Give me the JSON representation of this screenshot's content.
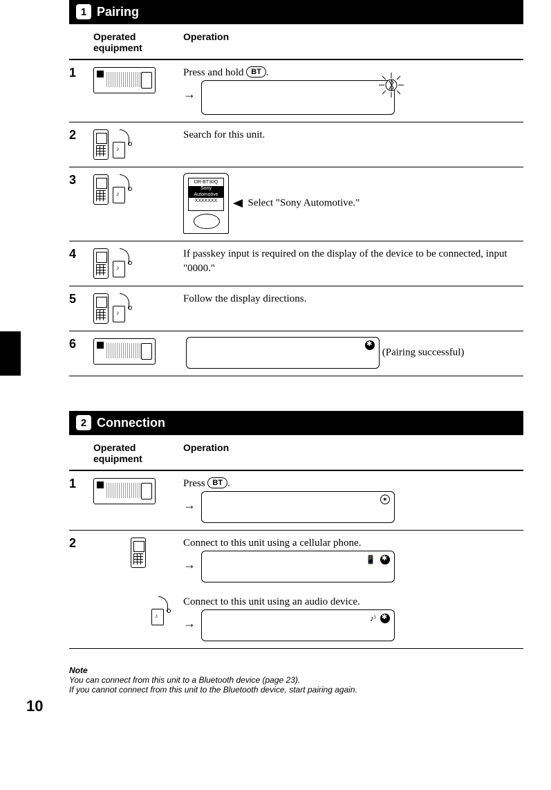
{
  "sections": {
    "pairing": {
      "badge": "1",
      "title": "Pairing",
      "col_equipment": "Operated equipment",
      "col_operation": "Operation",
      "steps": {
        "s1": {
          "num": "1",
          "text_a": "Press and hold ",
          "btn": "BT",
          "text_b": "."
        },
        "s2": {
          "num": "2",
          "text": "Search for this unit."
        },
        "s3": {
          "num": "3",
          "device_lines": {
            "l1": "DR-BT30Q",
            "l2": "Sony Automotive",
            "l3": "XXXXXXX"
          },
          "text": "Select \"Sony Automotive.\""
        },
        "s4": {
          "num": "4",
          "text": "If passkey input is required on the display of the device to be connected, input \"0000.\""
        },
        "s5": {
          "num": "5",
          "text": "Follow the display directions."
        },
        "s6": {
          "num": "6",
          "text": "(Pairing successful)"
        }
      }
    },
    "connection": {
      "badge": "2",
      "title": "Connection",
      "col_equipment": "Operated equipment",
      "col_operation": "Operation",
      "steps": {
        "s1": {
          "num": "1",
          "text_a": "Press ",
          "btn": "BT",
          "text_b": "."
        },
        "s2": {
          "num": "2",
          "text_phone": "Connect to this unit using a cellular phone.",
          "text_audio": "Connect to this unit using an audio device."
        }
      }
    }
  },
  "note": {
    "heading": "Note",
    "line1": "You can connect from this unit to a Bluetooth device (page 23).",
    "line2": "If you cannot connect from this unit to the Bluetooth device, start pairing again."
  },
  "page_number": "10"
}
